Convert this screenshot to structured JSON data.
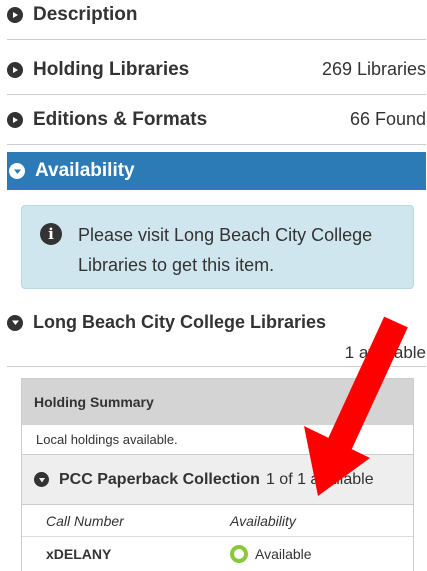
{
  "sections": {
    "description": {
      "title": "Description"
    },
    "holding_libraries": {
      "title": "Holding Libraries",
      "count": "269 Libraries"
    },
    "editions": {
      "title": "Editions & Formats",
      "count": "66 Found"
    },
    "availability": {
      "title": "Availability"
    }
  },
  "info": {
    "message": "Please visit Long Beach City College Libraries to get this item."
  },
  "library": {
    "name": "Long Beach City College Libraries",
    "count": "1 available"
  },
  "holding_summary": {
    "header": "Holding Summary",
    "local_note": "Local holdings available.",
    "collection": {
      "name": "PCC Paperback Collection",
      "availability": "1 of 1 available"
    },
    "columns": [
      "Call Number",
      "Availability"
    ],
    "rows": [
      {
        "call_number": "xDELANY",
        "status": "Available"
      }
    ]
  },
  "colors": {
    "accent": "#2c7bb6",
    "info_bg": "#d0e6ee",
    "available": "#8cc63f",
    "arrow": "#ff0000"
  },
  "icons": {
    "collapsed": "circle-play-icon",
    "expanded": "circle-chevron-down-icon",
    "info": "info-circle-icon",
    "status": "available-ring-icon",
    "annotation": "red-arrow-icon"
  }
}
